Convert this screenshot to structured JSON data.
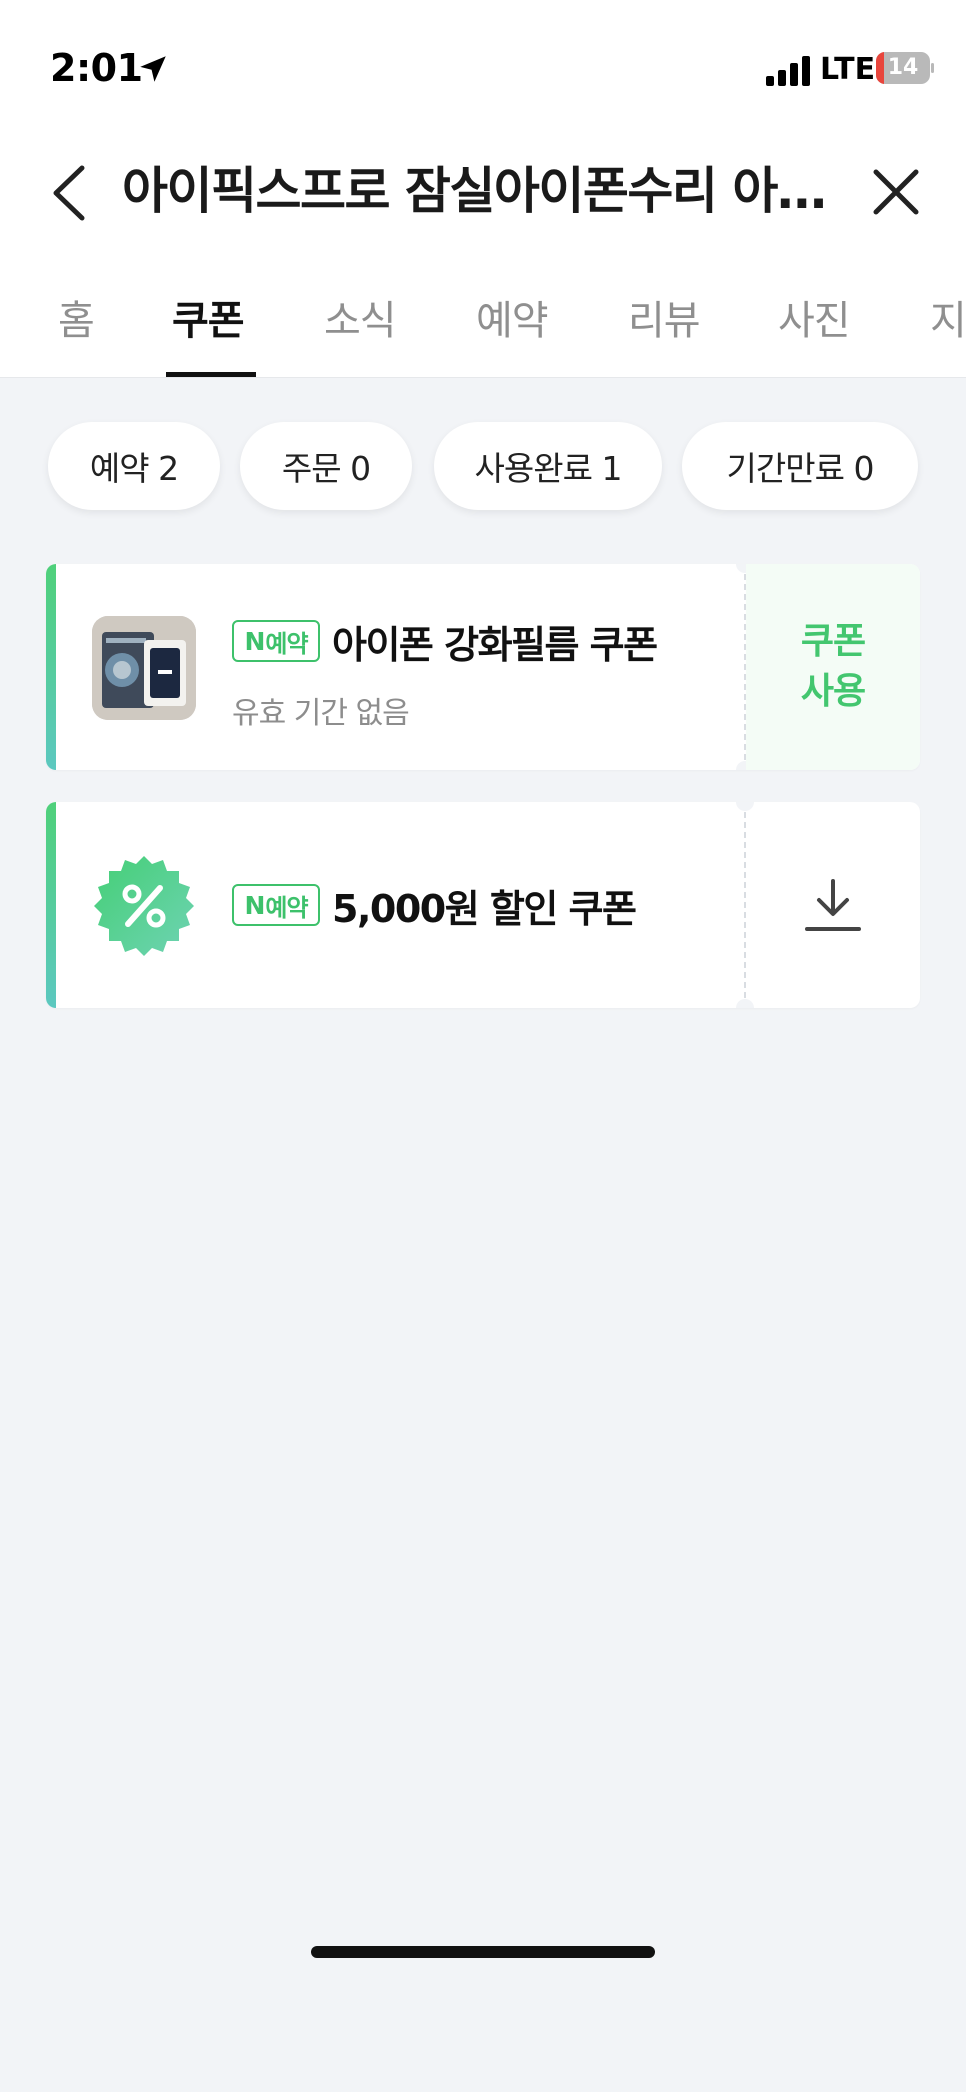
{
  "status_bar": {
    "time": "2:01",
    "network": "LTE",
    "battery_level": "14",
    "icons": [
      "location-arrow-icon",
      "signal-icon",
      "battery-icon"
    ]
  },
  "header": {
    "title": "아이픽스프로 잠실아이폰수리 아이폰액정수리 아이패드수리",
    "back_icon": "chevron-left-icon",
    "close_icon": "close-icon"
  },
  "tabs": [
    {
      "label": "홈",
      "active": false
    },
    {
      "label": "쿠폰",
      "active": true
    },
    {
      "label": "소식",
      "active": false
    },
    {
      "label": "예약",
      "active": false
    },
    {
      "label": "리뷰",
      "active": false
    },
    {
      "label": "사진",
      "active": false
    },
    {
      "label": "지도",
      "active": false
    }
  ],
  "filters": [
    {
      "label": "예약 2"
    },
    {
      "label": "주문 0"
    },
    {
      "label": "사용완료 1"
    },
    {
      "label": "기간만료 0"
    }
  ],
  "coupons": [
    {
      "badge_n": "N",
      "badge_label": "예약",
      "title": "아이폰 강화필름 쿠폰",
      "subtitle": "유효 기간 없음",
      "action_label": "쿠폰\n사용",
      "thumb": "product-photo"
    },
    {
      "badge_n": "N",
      "badge_label": "예약",
      "title": "5,000원 할인 쿠폰",
      "action_icon": "download-icon",
      "thumb": "percent-badge-icon"
    }
  ],
  "colors": {
    "accent_green": "#3dc16b",
    "background": "#f2f4f7"
  }
}
